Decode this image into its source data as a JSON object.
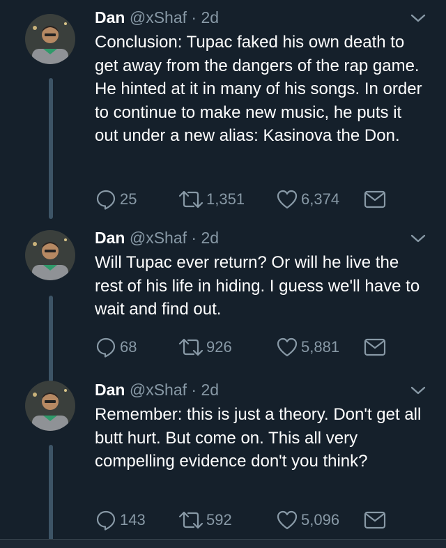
{
  "colors": {
    "background": "#15202b",
    "secondary_text": "#8899a6",
    "thread_line": "#3d5466"
  },
  "icons": {
    "reply": "reply-icon",
    "retweet": "retweet-icon",
    "like": "heart-icon",
    "message": "envelope-icon",
    "more": "chevron-down-icon"
  },
  "tweets": [
    {
      "name": "Dan",
      "handle": "@xShaf",
      "separator": "·",
      "time": "2d",
      "text": "Conclusion: Tupac faked his own death to get away from the dangers of the rap game. He hinted at it in many of his songs.  In order to continue to make new music, he puts it out under a new alias: Kasinova the Don.",
      "replies": "25",
      "retweets": "1,351",
      "likes": "6,374"
    },
    {
      "name": "Dan",
      "handle": "@xShaf",
      "separator": "·",
      "time": "2d",
      "text": "Will Tupac ever return? Or will he live the rest of his life in hiding. I guess we'll have to wait and find out.",
      "replies": "68",
      "retweets": "926",
      "likes": "5,881"
    },
    {
      "name": "Dan",
      "handle": "@xShaf",
      "separator": "·",
      "time": "2d",
      "text": "Remember: this is just a theory. Don't get all butt hurt. But come on. This all very compelling evidence don't you think?",
      "replies": "143",
      "retweets": "592",
      "likes": "5,096"
    }
  ]
}
